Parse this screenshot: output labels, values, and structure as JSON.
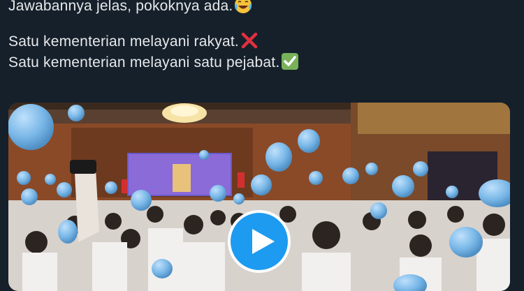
{
  "tweet": {
    "lines": [
      {
        "text": "Jawabannya jelas, pokoknya ada.",
        "emoji": "face-with-tears-of-joy-icon"
      },
      {
        "text": "Satu kementerian melayani rakyat.",
        "emoji": "cross-mark-icon"
      },
      {
        "text": "Satu kementerian melayani satu pejabat.",
        "emoji": "check-mark-button-icon"
      }
    ]
  },
  "media": {
    "type": "video",
    "play_icon": "play-icon",
    "scene": "event hall with crowd and light blue balloons",
    "colors": {
      "accent": "#1d9bf0",
      "balloon": "#7ab8e8",
      "background": "#15202b"
    }
  }
}
